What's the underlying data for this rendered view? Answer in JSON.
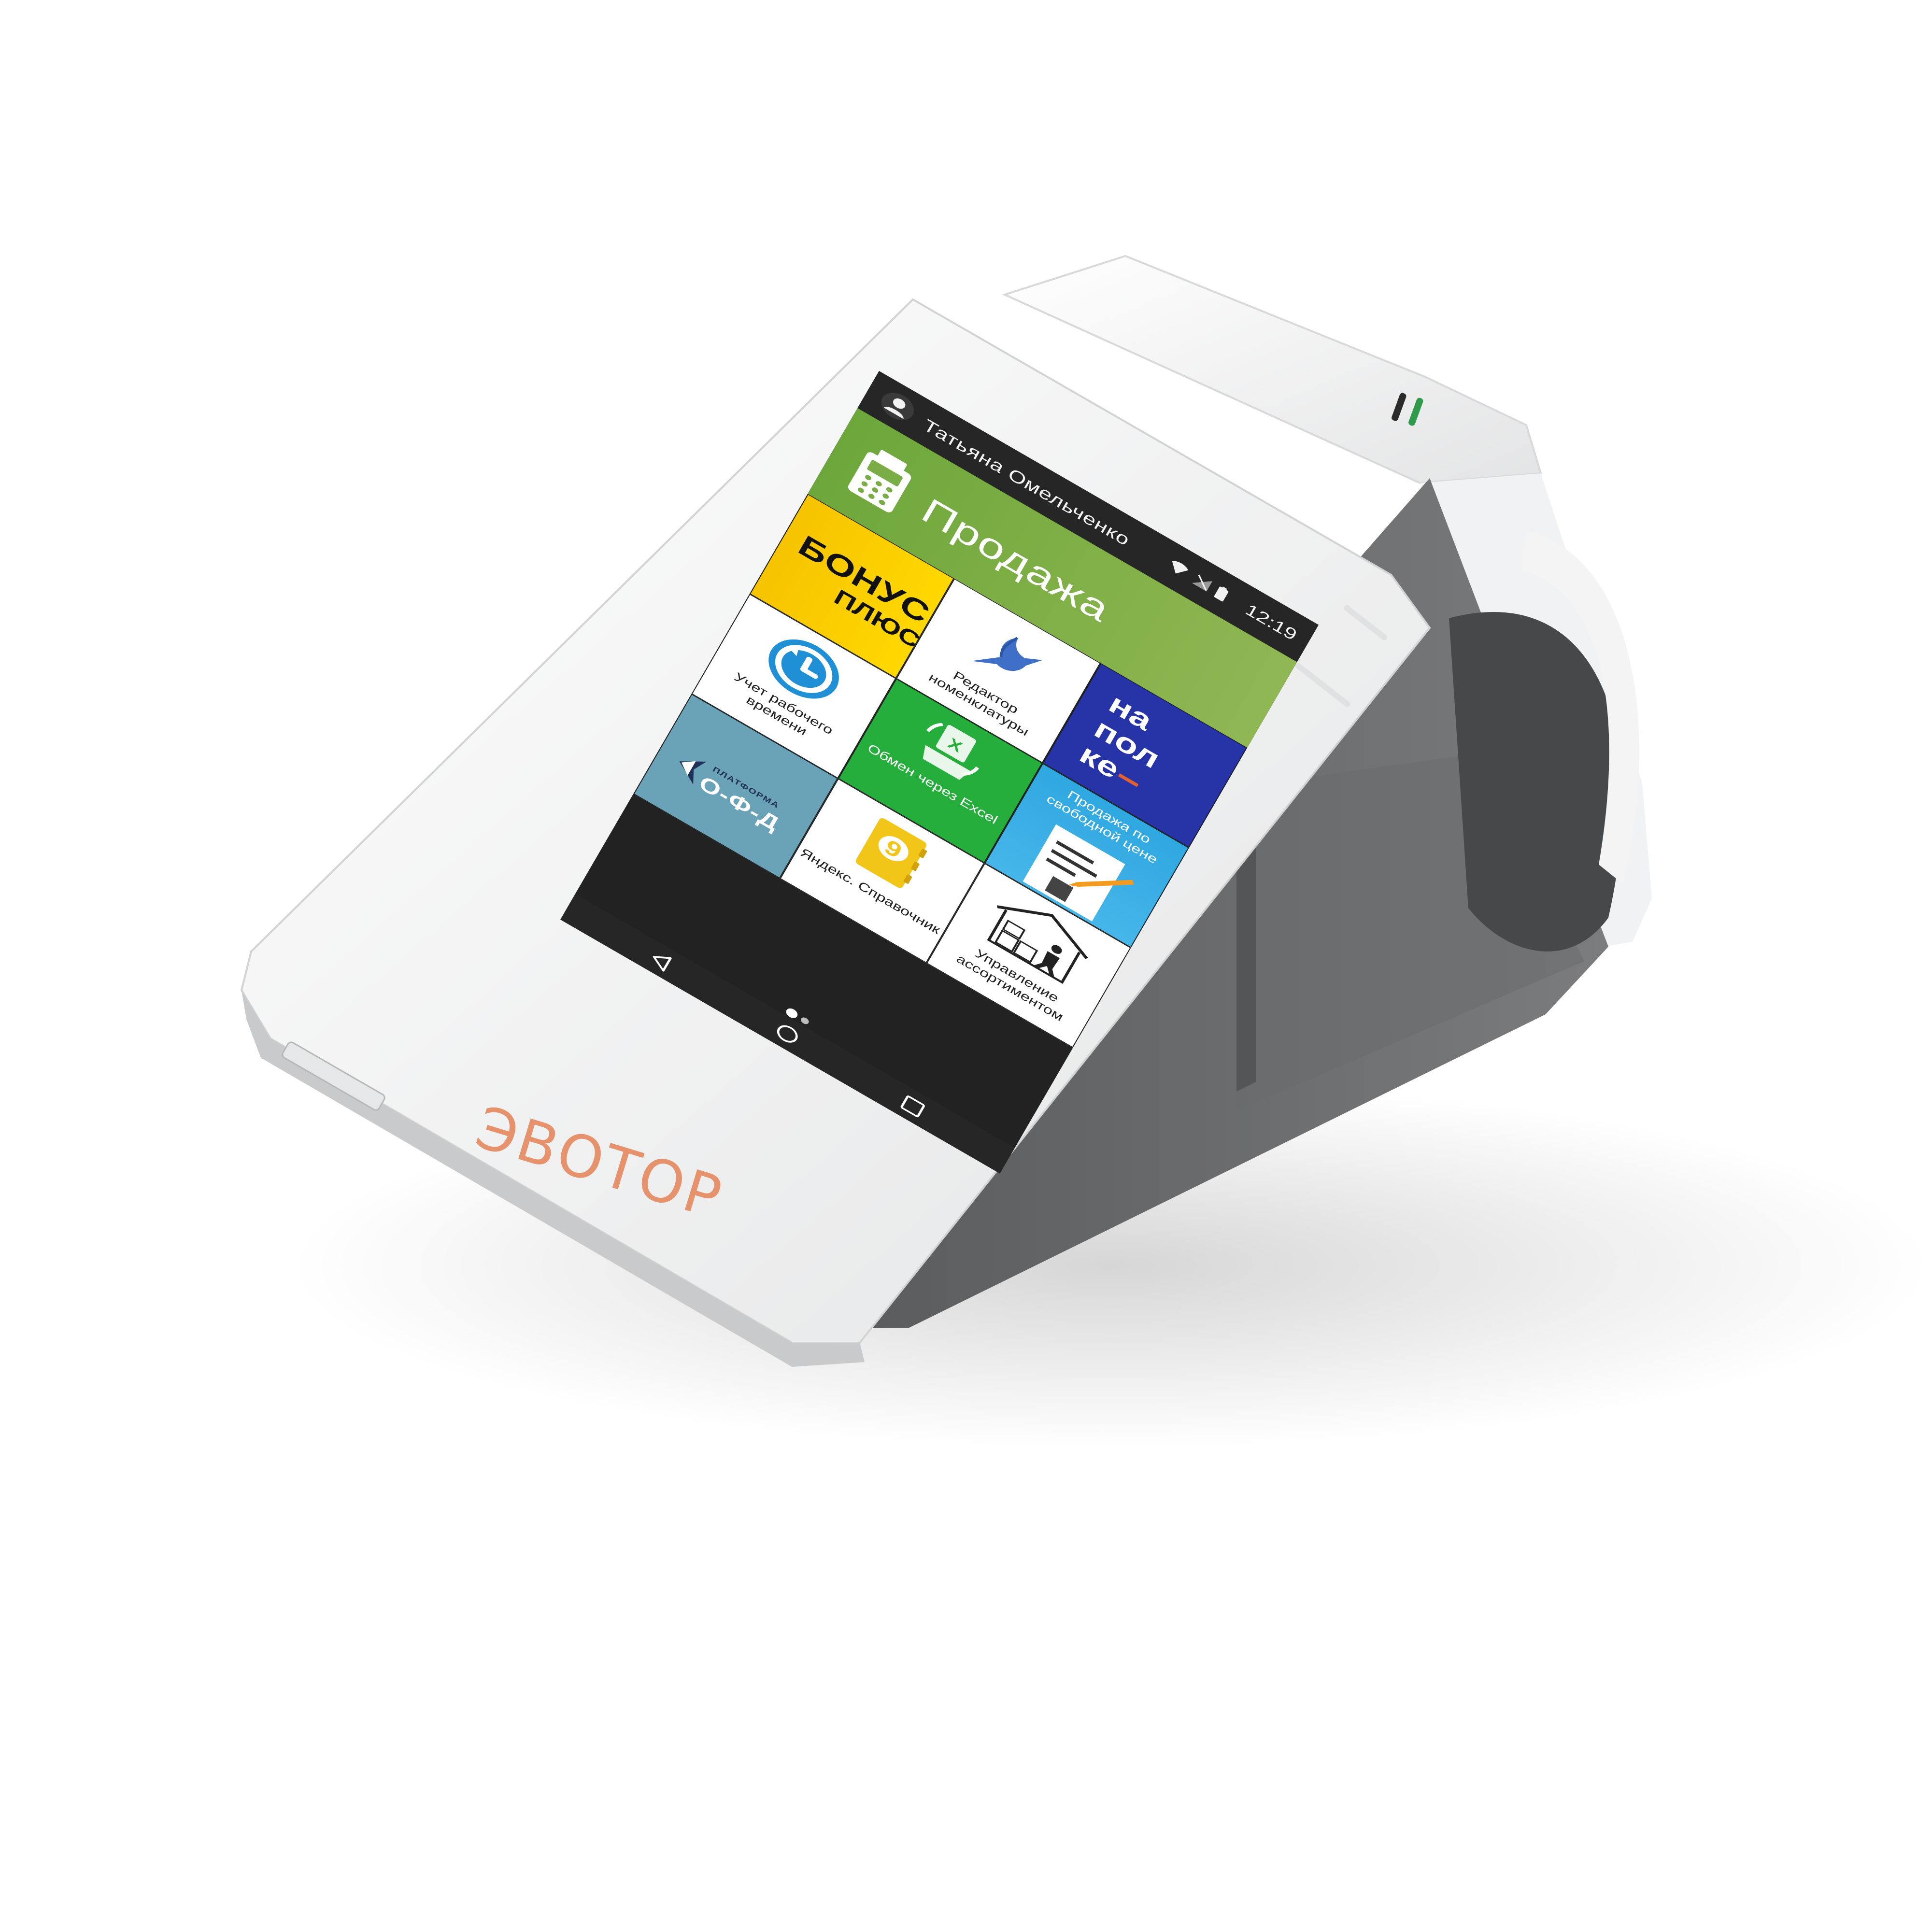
{
  "status_bar": {
    "user_name": "Татьяна Омельченко",
    "time": "12:19",
    "icons": [
      "wifi-icon",
      "signal-off-icon",
      "battery-icon"
    ]
  },
  "main_action": {
    "label": "Продажа",
    "icon": "cash-terminal-icon"
  },
  "tiles": [
    {
      "id": "bonus_plus",
      "line1": "БОНУС",
      "line2": "ПЛЮС"
    },
    {
      "id": "catalog_editor",
      "label": "Редактор номенклатуры",
      "icon": "hummingbird-icon"
    },
    {
      "id": "napolke",
      "line1": "на",
      "line2": "пол",
      "line3": "ке"
    },
    {
      "id": "time_tracking",
      "label": "Учет рабочего времени",
      "icon": "clock-refresh-icon"
    },
    {
      "id": "excel_exchange",
      "label": "Обмен через Excel",
      "icon": "excel-sync-icon"
    },
    {
      "id": "free_price_sale",
      "label": "Продажа по свободной цене",
      "icon": "receipt-pen-icon"
    },
    {
      "id": "ofd_platform",
      "small": "ПЛАТФОРМА",
      "big": "О-Ф-Д"
    },
    {
      "id": "yandex_directory",
      "label": "Яндекс. Справочник",
      "icon": "yandex-directory-icon"
    },
    {
      "id": "assortment",
      "label": "Управление ассортиментом",
      "icon": "warehouse-icon"
    }
  ],
  "navigation": {
    "buttons": [
      "back-icon",
      "home-icon",
      "recents-icon"
    ],
    "pages": 2,
    "current_page": 1
  },
  "device": {
    "brand": "ЭВОТОР"
  },
  "colors": {
    "banner": "#7aad45",
    "bonus": "#ffd200",
    "napolke": "#2734a8",
    "excel": "#25ae3b",
    "free_price": "#3aaee5",
    "ofd": "#6aa3b8",
    "brand_text": "#e6926c"
  }
}
